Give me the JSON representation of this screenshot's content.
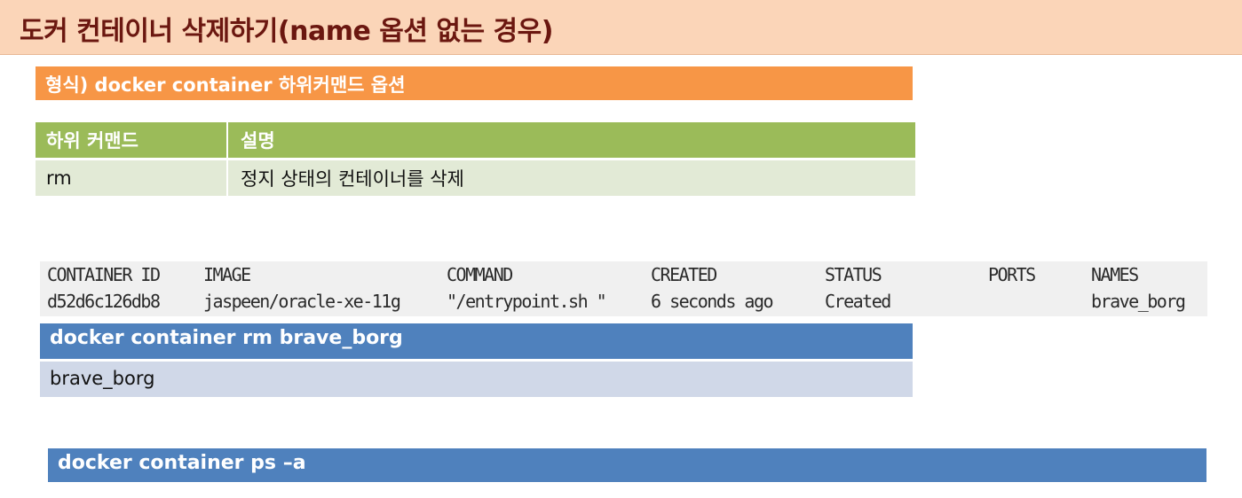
{
  "title": "도커 컨테이너 삭제하기(name 옵션 없는 경우)",
  "format_line": "형식) docker container 하위커맨드 옵션",
  "command_table": {
    "headers": [
      "하위 커맨드",
      "설명"
    ],
    "rows": [
      {
        "command": "rm",
        "description": "정지 상태의 컨테이너를 삭제"
      }
    ]
  },
  "container_listing": {
    "columns": [
      {
        "header": "CONTAINER ID",
        "value": "d52d6c126db8"
      },
      {
        "header": "IMAGE",
        "value": "jaspeen/oracle-xe-11g"
      },
      {
        "header": "COMMAND",
        "value": "\"/entrypoint.sh \""
      },
      {
        "header": "CREATED",
        "value": "6 seconds ago"
      },
      {
        "header": "STATUS",
        "value": "Created"
      },
      {
        "header": "PORTS",
        "value": ""
      },
      {
        "header": "NAMES",
        "value": "brave_borg"
      }
    ]
  },
  "rm_command": "docker container rm brave_borg",
  "rm_output": "brave_borg",
  "ps_command": "docker container ps –a",
  "colors": {
    "title_background": "#fbd5b8",
    "title_text": "#6b1710",
    "format_bar": "#f79646",
    "table_header": "#9bbb59",
    "table_row": "#e2ead6",
    "command_bar": "#4f81bd",
    "output_bar": "#d0d8e8",
    "terminal_background": "#f0f0f0"
  }
}
